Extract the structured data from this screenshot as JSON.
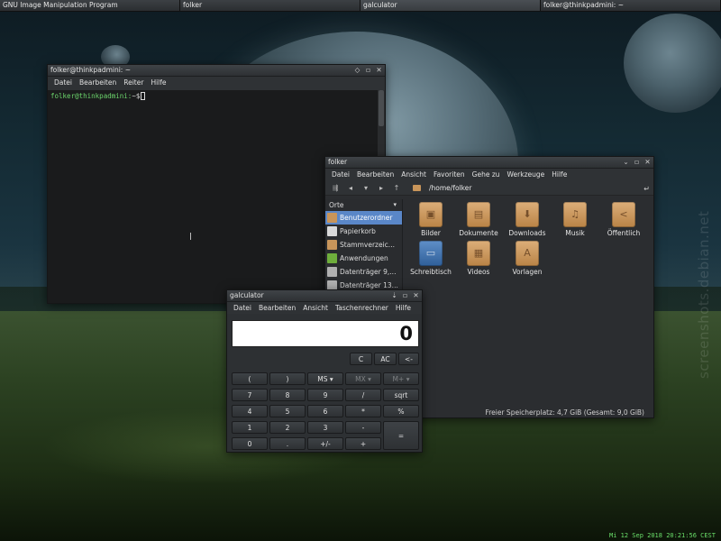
{
  "taskbar": {
    "tasks": [
      {
        "label": "GNU Image Manipulation Program"
      },
      {
        "label": "folker"
      },
      {
        "label": "galculator"
      },
      {
        "label": "folker@thinkpadmini: ~"
      }
    ]
  },
  "desktop": {
    "watermark": "screenshots.debian.net",
    "clock": "Mi 12 Sep 2018 20:21:56 CEST"
  },
  "terminal": {
    "title": "folker@thinkpadmini: ~",
    "menu": [
      "Datei",
      "Bearbeiten",
      "Reiter",
      "Hilfe"
    ],
    "prompt_user": "folker@thinkpadmini:",
    "prompt_path": "~$"
  },
  "filemanager": {
    "title": "folker",
    "menu": [
      "Datei",
      "Bearbeiten",
      "Ansicht",
      "Favoriten",
      "Gehe zu",
      "Werkzeuge",
      "Hilfe"
    ],
    "path": "/home/folker",
    "sidebar_header": "Orte",
    "sidebar": [
      {
        "label": "Benutzerordner",
        "color": "#c8955a"
      },
      {
        "label": "Papierkorb",
        "color": "#d9d9d9"
      },
      {
        "label": "Stammverzeic...",
        "color": "#c8955a"
      },
      {
        "label": "Anwendungen",
        "color": "#6fae3c"
      },
      {
        "label": "Datenträger 9,...",
        "color": "#b0b0b0"
      },
      {
        "label": "Datenträger 13...",
        "color": "#b0b0b0"
      }
    ],
    "icons": [
      {
        "label": "Bilder",
        "icon": "image-icon"
      },
      {
        "label": "Dokumente",
        "icon": "document-icon"
      },
      {
        "label": "Downloads",
        "icon": "download-icon"
      },
      {
        "label": "Musik",
        "icon": "music-icon"
      },
      {
        "label": "Öffentlich",
        "icon": "share-icon"
      },
      {
        "label": "Schreibtisch",
        "icon": "desktop-icon"
      },
      {
        "label": "Videos",
        "icon": "video-icon"
      },
      {
        "label": "Vorlagen",
        "icon": "template-icon"
      }
    ],
    "status": "Freier Speicherplatz: 4,7 GiB (Gesamt: 9,0 GiB)"
  },
  "calculator": {
    "title": "galculator",
    "menu": [
      "Datei",
      "Bearbeiten",
      "Ansicht",
      "Taschenrechner",
      "Hilfe"
    ],
    "display": "0",
    "buttons": {
      "c": "C",
      "ac": "AC",
      "back": "<-",
      "paren_open": "(",
      "paren_close": ")",
      "ms": "MS",
      "mx": "MX",
      "mplus": "M+",
      "n7": "7",
      "n8": "8",
      "n9": "9",
      "div": "/",
      "sqrt": "sqrt",
      "n4": "4",
      "n5": "5",
      "n6": "6",
      "mul": "*",
      "pct": "%",
      "n1": "1",
      "n2": "2",
      "n3": "3",
      "minus": "-",
      "eq": "=",
      "n0": "0",
      "dot": ".",
      "sign": "+/-",
      "plus": "+"
    }
  }
}
